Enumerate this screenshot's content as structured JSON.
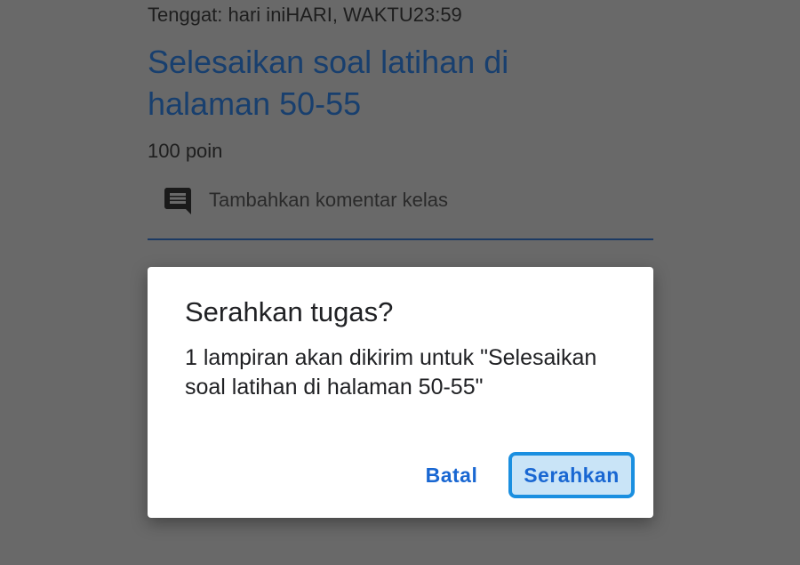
{
  "assignment": {
    "due_text": "Tenggat: hari iniHARI, WAKTU23:59",
    "title": "Selesaikan soal latihan di halaman 50-55",
    "points": "100 poin",
    "comment_placeholder": "Tambahkan komentar kelas",
    "comment_icon": "comment-icon"
  },
  "dialog": {
    "title": "Serahkan tugas?",
    "message": "1 lampiran akan dikirim untuk \"Selesaikan soal latihan di halaman 50-55\"",
    "cancel_label": "Batal",
    "submit_label": "Serahkan"
  },
  "colors": {
    "scrim": "#696969",
    "accent": "#1967d2",
    "focus_ring": "#1a8fe0"
  }
}
